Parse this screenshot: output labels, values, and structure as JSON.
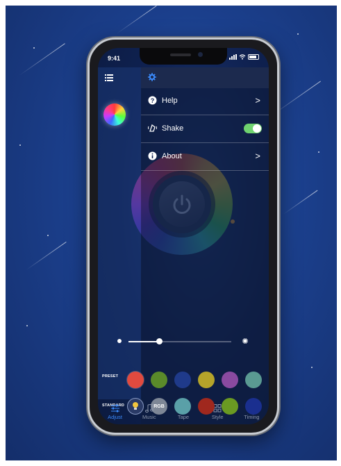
{
  "status_bar": {
    "time": "9:41"
  },
  "drawer": {
    "items": [
      {
        "label": "Help",
        "icon": "help-icon",
        "trailing": ">"
      },
      {
        "label": "Shake",
        "icon": "shake-icon",
        "toggle_on": true
      },
      {
        "label": "About",
        "icon": "info-icon",
        "trailing": ">"
      }
    ]
  },
  "brightness": {
    "level": 0.3
  },
  "rows": {
    "preset_label": "PRESET",
    "standard_label": "STANDARD",
    "rgb_label": "RGB",
    "preset_colors": [
      "#e14a3f",
      "#5a8a2a",
      "#1f3a8a",
      "#b5a42a",
      "#8a4aa0",
      "#5a9a92"
    ],
    "standard_colors": [
      "#5aa0a8",
      "#a0281e",
      "#6a9a22",
      "#1a2f8f"
    ]
  },
  "tabs": [
    {
      "label": "Adjust",
      "icon": "sliders-icon",
      "active": true
    },
    {
      "label": "Music",
      "icon": "music-note-icon",
      "active": false
    },
    {
      "label": "Tape",
      "icon": "tape-icon",
      "active": false
    },
    {
      "label": "Style",
      "icon": "grid-icon",
      "active": false
    },
    {
      "label": "Timing",
      "icon": "clock-icon",
      "active": false
    }
  ],
  "colors": {
    "accent_blue": "#3b8cff",
    "toggle_green": "#6fd36f"
  }
}
